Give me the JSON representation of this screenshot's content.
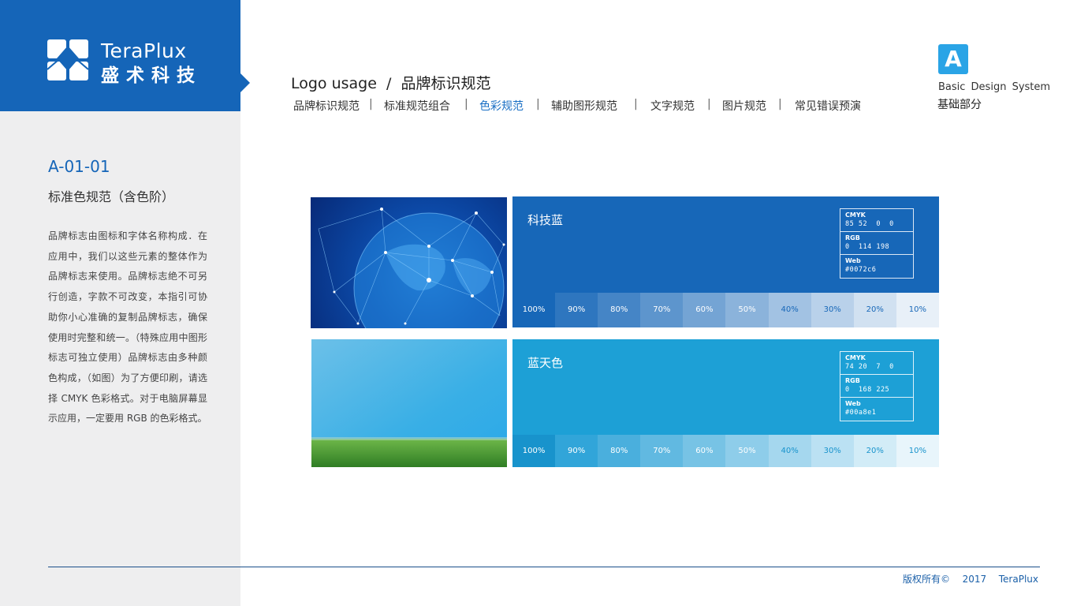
{
  "brand": {
    "name_en": "TeraPlux",
    "name_cn": "盛术科技"
  },
  "sidebar": {
    "code": "A-01-01",
    "subtitle": "标准色规范（含色阶）",
    "description": "品牌标志由图标和字体名称构成．在应用中，我们以这些元素的整体作为品牌标志来使用。品牌标志绝不可另行创造，字款不可改变，本指引可协助你小心准确的复制品牌标志，确保使用时完整和统一。（特殊应用中图形标志可独立使用）品牌标志由多种颜色构成，（如图）为了方便印刷，请选择 CMYK 色彩格式。对于电脑屏幕显示应用，一定要用 RGB 的色彩格式。"
  },
  "header": {
    "title": "Logo usage  /  品牌标识规范",
    "nav": [
      {
        "label": "品牌标识规范",
        "active": false
      },
      {
        "label": "标准规范组合",
        "active": false
      },
      {
        "label": "色彩规范",
        "active": true
      },
      {
        "label": "辅助图形规范",
        "active": false
      },
      {
        "label": "文字规范",
        "active": false
      },
      {
        "label": "图片规范",
        "active": false
      },
      {
        "label": "常见错误预演",
        "active": false
      }
    ],
    "separator": "|",
    "badge": "A",
    "system_en": "Basic Design System",
    "system_cn": "基础部分"
  },
  "colors": [
    {
      "name": "科技蓝",
      "cmyk_label": "CMYK",
      "cmyk": "85 52  0  0",
      "rgb_label": "RGB",
      "rgb": "0  114 198",
      "web_label": "Web",
      "web": "#0072c6",
      "hex": "#1767b8",
      "tints": [
        "100%",
        "90%",
        "80%",
        "70%",
        "60%",
        "50%",
        "40%",
        "30%",
        "20%",
        "10%"
      ],
      "tint_colors": [
        "#1767b8",
        "#2e76bf",
        "#4585c6",
        "#5d95cd",
        "#74a4d4",
        "#8bb3db",
        "#a2c2e3",
        "#b9d1ea",
        "#d1e1f1",
        "#e8f0f8"
      ]
    },
    {
      "name": "蓝天色",
      "cmyk_label": "CMYK",
      "cmyk": "74 20  7  0",
      "rgb_label": "RGB",
      "rgb": "0  168 225",
      "web_label": "Web",
      "web": "#00a8e1",
      "hex": "#1da0d6",
      "tints": [
        "100%",
        "90%",
        "80%",
        "70%",
        "60%",
        "50%",
        "40%",
        "30%",
        "20%",
        "10%"
      ],
      "tint_colors": [
        "#1893cc",
        "#31a5d9",
        "#4aafdd",
        "#61b9e1",
        "#77c3e5",
        "#8ecdea",
        "#a5d7ee",
        "#bbe1f3",
        "#d2ecf7",
        "#e8f5fb"
      ]
    }
  ],
  "footer": {
    "text": "版权所有©  2017  TeraPlux"
  }
}
